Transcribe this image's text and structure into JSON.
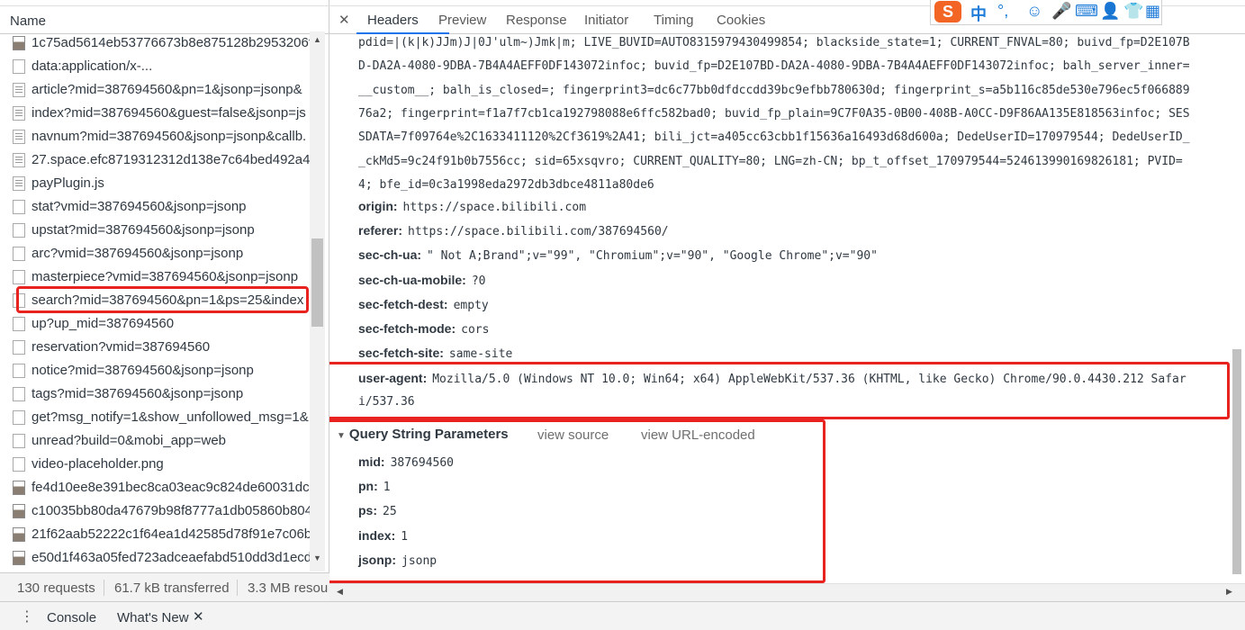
{
  "left_panel": {
    "column_header": "Name",
    "requests": [
      {
        "name": "1c75ad5614eb53776673b8e875128b2953206f.",
        "icon": "image-file-icon"
      },
      {
        "name": "data:application/x-...",
        "icon": "blank-file-icon"
      },
      {
        "name": "article?mid=387694560&pn=1&jsonp=jsonp&",
        "icon": "document-icon"
      },
      {
        "name": "index?mid=387694560&guest=false&jsonp=js",
        "icon": "document-icon"
      },
      {
        "name": "navnum?mid=387694560&jsonp=jsonp&callb.",
        "icon": "document-icon"
      },
      {
        "name": "27.space.efc8719312312d138e7c64bed492a48",
        "icon": "document-icon"
      },
      {
        "name": "payPlugin.js",
        "icon": "document-icon"
      },
      {
        "name": "stat?vmid=387694560&jsonp=jsonp",
        "icon": "blank-file-icon"
      },
      {
        "name": "upstat?mid=387694560&jsonp=jsonp",
        "icon": "blank-file-icon"
      },
      {
        "name": "arc?vmid=387694560&jsonp=jsonp",
        "icon": "blank-file-icon"
      },
      {
        "name": "masterpiece?vmid=387694560&jsonp=jsonp",
        "icon": "blank-file-icon"
      },
      {
        "name": "search?mid=387694560&pn=1&ps=25&index",
        "icon": "blank-file-icon"
      },
      {
        "name": "up?up_mid=387694560",
        "icon": "blank-file-icon"
      },
      {
        "name": "reservation?vmid=387694560",
        "icon": "blank-file-icon"
      },
      {
        "name": "notice?mid=387694560&jsonp=jsonp",
        "icon": "blank-file-icon"
      },
      {
        "name": "tags?mid=387694560&jsonp=jsonp",
        "icon": "blank-file-icon"
      },
      {
        "name": "get?msg_notify=1&show_unfollowed_msg=1&",
        "icon": "blank-file-icon"
      },
      {
        "name": "unread?build=0&mobi_app=web",
        "icon": "blank-file-icon"
      },
      {
        "name": "video-placeholder.png",
        "icon": "blank-file-icon"
      },
      {
        "name": "fe4d10ee8e391bec8ca03eac9c824de60031dce",
        "icon": "image-file-icon"
      },
      {
        "name": "c10035bb80da47679b98f8777a1db05860b804",
        "icon": "image-file-icon"
      },
      {
        "name": "21f62aab52222c1f64ea1d42585d78f91e7c06b.",
        "icon": "image-file-icon"
      },
      {
        "name": "e50d1f463a05fed723adceaefabd510dd3d1ecd",
        "icon": "image-file-icon"
      }
    ],
    "status": {
      "requests": "130 requests",
      "transferred": "61.7 kB transferred",
      "resources": "3.3 MB resou"
    }
  },
  "tabs": [
    "Headers",
    "Preview",
    "Response",
    "Initiator",
    "Timing",
    "Cookies"
  ],
  "active_tab": "Headers",
  "cookie_lines": [
    "pdid=|(k|k)JJm)J|0J'ulm~)Jmk|m; LIVE_BUVID=AUTO8315979430499854; blackside_state=1; CURRENT_FNVAL=80; buivd_fp=D2E107B",
    "D-DA2A-4080-9DBA-7B4A4AEFF0DF143072infoc; buvid_fp=D2E107BD-DA2A-4080-9DBA-7B4A4AEFF0DF143072infoc; balh_server_inner=",
    "__custom__; balh_is_closed=; fingerprint3=dc6c77bb0dfdccdd39bc9efbb780630d; fingerprint_s=a5b116c85de530e796ec5f066889",
    "76a2; fingerprint=f1a7f7cb1ca192798088e6ffc582bad0; buvid_fp_plain=9C7F0A35-0B00-408B-A0CC-D9F86AA135E818563infoc; SES",
    "SDATA=7f09764e%2C1633411120%2Cf3619%2A41; bili_jct=a405cc63cbb1f15636a16493d68d600a; DedeUserID=170979544; DedeUserID_",
    "_ckMd5=9c24f91b0b7556cc; sid=65xsqvro; CURRENT_QUALITY=80; LNG=zh-CN; bp_t_offset_170979544=524613990169826181; PVID=",
    "4; bfe_id=0c3a1998eda2972db3dbce4811a80de6"
  ],
  "headers": [
    {
      "name": "origin:",
      "value": "https://space.bilibili.com"
    },
    {
      "name": "referer:",
      "value": "https://space.bilibili.com/387694560/"
    },
    {
      "name": "sec-ch-ua:",
      "value": "\" Not A;Brand\";v=\"99\", \"Chromium\";v=\"90\", \"Google Chrome\";v=\"90\""
    },
    {
      "name": "sec-ch-ua-mobile:",
      "value": "?0"
    },
    {
      "name": "sec-fetch-dest:",
      "value": "empty"
    },
    {
      "name": "sec-fetch-mode:",
      "value": "cors"
    },
    {
      "name": "sec-fetch-site:",
      "value": "same-site"
    }
  ],
  "user_agent": {
    "name": "user-agent:",
    "value": "Mozilla/5.0 (Windows NT 10.0; Win64; x64) AppleWebKit/537.36 (KHTML, like Gecko) Chrome/90.0.4430.212 Safar",
    "value_cont": "i/537.36"
  },
  "query_string": {
    "title": "Query String Parameters",
    "view_source": "view source",
    "view_url_encoded": "view URL-encoded",
    "params": [
      {
        "name": "mid:",
        "value": "387694560"
      },
      {
        "name": "pn:",
        "value": "1"
      },
      {
        "name": "ps:",
        "value": "25"
      },
      {
        "name": "index:",
        "value": "1"
      },
      {
        "name": "jsonp:",
        "value": "jsonp"
      }
    ]
  },
  "ime_toolbar": {
    "logo": "S",
    "mode": "中",
    "punct": "°,",
    "items": [
      "emoji-icon",
      "mic-icon",
      "keyboard-icon",
      "user-icon",
      "skin-icon",
      "grid-icon"
    ]
  },
  "drawer": {
    "console": "Console",
    "whats_new": "What's New"
  },
  "colors": {
    "highlight_red": "#e8231f",
    "active_tab_underline": "#1a73e8"
  }
}
